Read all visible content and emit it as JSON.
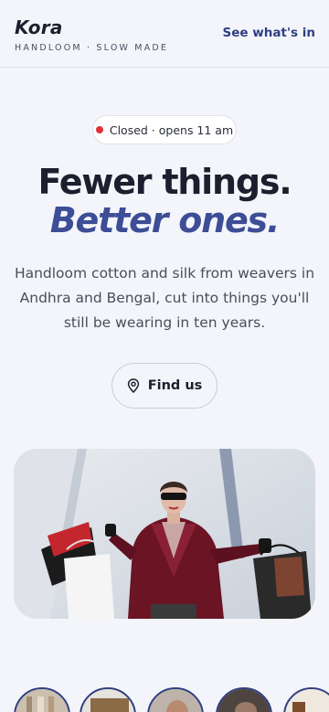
{
  "header": {
    "brand": "Kora",
    "tagline": "HANDLOOM · SLOW MADE",
    "cta": "See what's in"
  },
  "status": {
    "text": "Closed · opens 11 am",
    "dot_color": "#e0303a"
  },
  "hero": {
    "line1": "Fewer things.",
    "line2": "Better ones.",
    "lead": "Handloom cotton and silk from weavers in Andhra and Bengal, cut into things you'll still be wearing in ten years.",
    "button_label": "Find us",
    "button_icon": "map-pin-icon",
    "image": "woman-with-shopping-bags-photo"
  },
  "thumbnails": [
    {
      "name": "fabric-rack-thumbnail"
    },
    {
      "name": "product-thumbnail-2"
    },
    {
      "name": "person-thumbnail"
    },
    {
      "name": "product-thumbnail-4"
    },
    {
      "name": "product-thumbnail-5"
    }
  ],
  "colors": {
    "accent": "#3d4d96",
    "link": "#2f3f82",
    "background": "#f3f5fa",
    "text": "#1c1f2e"
  }
}
